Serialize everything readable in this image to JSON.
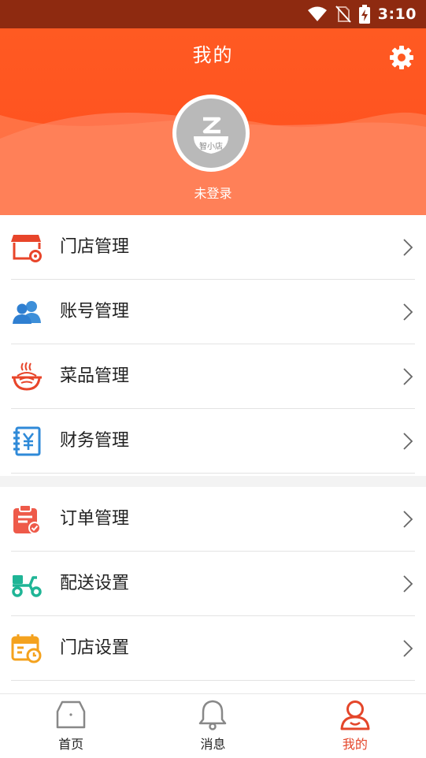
{
  "status_bar": {
    "time": "3:10"
  },
  "header": {
    "title": "我的",
    "avatar_text": "智小店",
    "login_status": "未登录"
  },
  "menu_groups": [
    {
      "items": [
        {
          "label": "门店管理",
          "icon": "store-gear-icon"
        },
        {
          "label": "账号管理",
          "icon": "people-icon"
        },
        {
          "label": "菜品管理",
          "icon": "dish-icon"
        },
        {
          "label": "财务管理",
          "icon": "yuan-ledger-icon"
        }
      ]
    },
    {
      "items": [
        {
          "label": "订单管理",
          "icon": "clipboard-check-icon"
        },
        {
          "label": "配送设置",
          "icon": "scooter-icon"
        },
        {
          "label": "门店设置",
          "icon": "calendar-clock-icon"
        }
      ]
    }
  ],
  "bottom_nav": [
    {
      "label": "首页",
      "icon": "home-icon",
      "active": false
    },
    {
      "label": "消息",
      "icon": "bell-icon",
      "active": false
    },
    {
      "label": "我的",
      "icon": "user-icon",
      "active": true
    }
  ],
  "colors": {
    "header": "#ff5a22",
    "active_tab": "#e4462a",
    "status_bar": "#8e2a10"
  }
}
